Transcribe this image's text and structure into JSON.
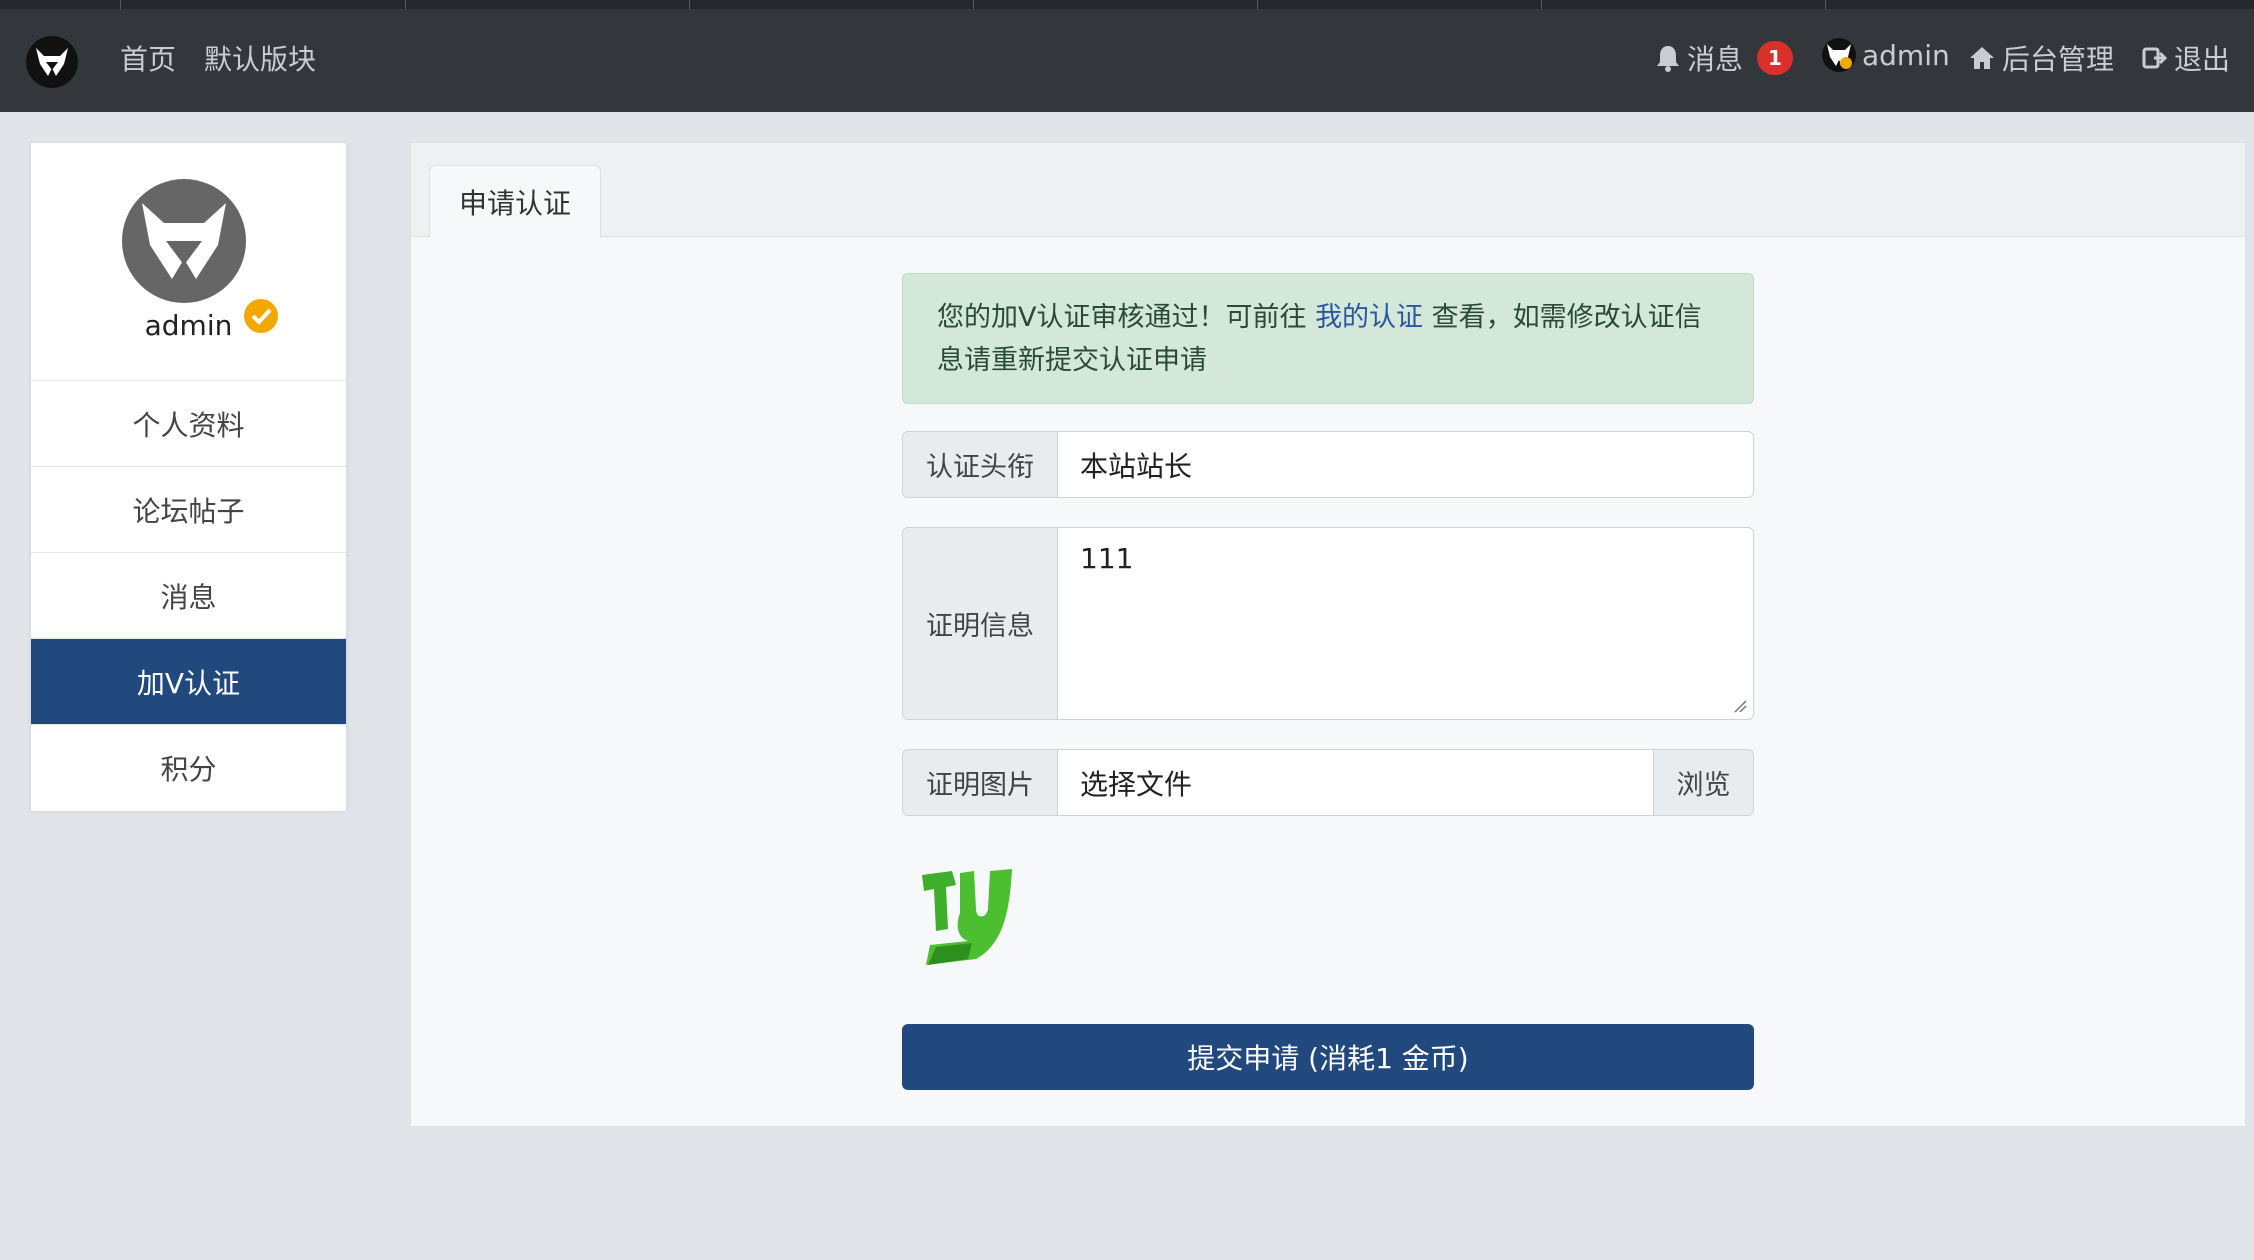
{
  "nav": {
    "home": "首页",
    "default_board": "默认版块",
    "messages_label": "消息",
    "messages_count": "1",
    "username": "admin",
    "admin_panel": "后台管理",
    "logout": "退出"
  },
  "sidebar": {
    "username": "admin",
    "items": [
      {
        "label": "个人资料"
      },
      {
        "label": "论坛帖子"
      },
      {
        "label": "消息"
      },
      {
        "label": "加V认证"
      },
      {
        "label": "积分"
      }
    ]
  },
  "panel": {
    "tab": "申请认证",
    "alert": {
      "before": "您的加V认证审核通过！可前往 ",
      "link": "我的认证",
      "after": " 查看，如需修改认证信息请重新提交认证申请"
    },
    "title_field": {
      "label": "认证头衔",
      "value": "本站站长"
    },
    "proof_field": {
      "label": "证明信息",
      "value": "111"
    },
    "image_field": {
      "label": "证明图片",
      "value": "选择文件",
      "browse": "浏览"
    },
    "submit": "提交申请 (消耗1 金币)"
  },
  "colors": {
    "primary": "#21497d",
    "topbar": "#33373c",
    "alert_bg": "#d4e8da",
    "badge": "#d9302b"
  }
}
